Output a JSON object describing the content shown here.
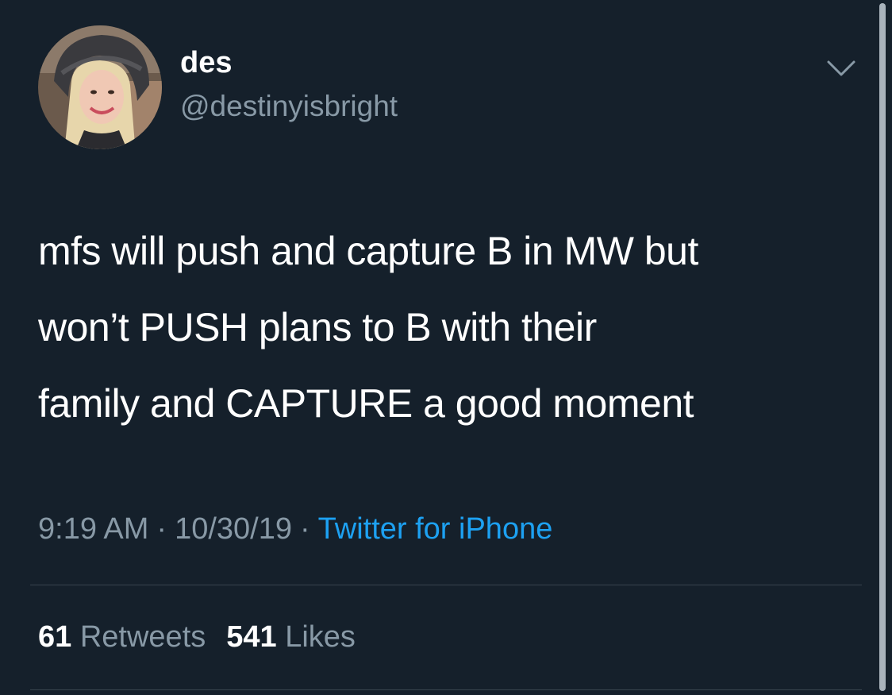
{
  "tweet": {
    "display_name": "des",
    "handle": "@destinyisbright",
    "text": "mfs will push and capture B in MW but\nwon’t PUSH plans to B with their\nfamily and CAPTURE a good moment",
    "time": "9:19 AM",
    "date": "10/30/19",
    "separator": "·",
    "source": "Twitter for iPhone",
    "retweets_count": "61",
    "retweets_label": "Retweets",
    "likes_count": "541",
    "likes_label": "Likes"
  },
  "icons": {
    "more": "chevron-down-icon",
    "avatar": "profile-photo"
  },
  "colors": {
    "background": "#15202b",
    "primary_text": "#ffffff",
    "secondary_text": "#8899a6",
    "link": "#1da1f2",
    "divider": "#38444d"
  }
}
